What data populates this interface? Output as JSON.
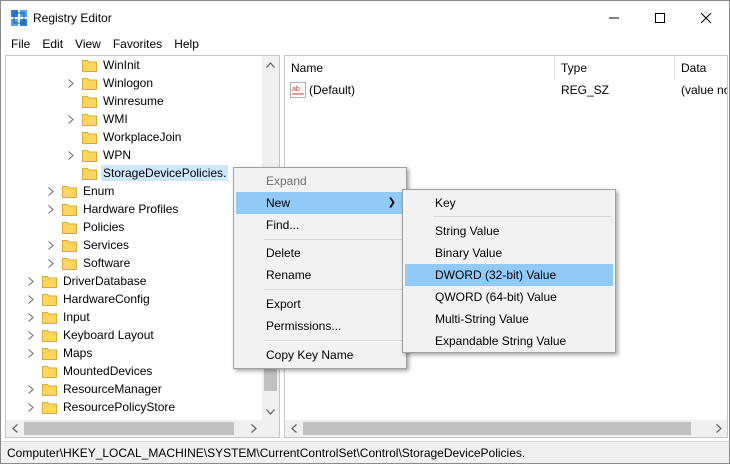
{
  "window": {
    "title": "Registry Editor",
    "controls": {
      "minimize": "minimize",
      "maximize": "maximize",
      "close": "close"
    }
  },
  "menubar": [
    "File",
    "Edit",
    "View",
    "Favorites",
    "Help"
  ],
  "tree": {
    "items": [
      {
        "label": "WinInit",
        "expandable": false
      },
      {
        "label": "Winlogon",
        "expandable": true
      },
      {
        "label": "Winresume",
        "expandable": false
      },
      {
        "label": "WMI",
        "expandable": true
      },
      {
        "label": "WorkplaceJoin",
        "expandable": false
      },
      {
        "label": "WPN",
        "expandable": true
      },
      {
        "label": "StorageDevicePolicies.",
        "expandable": false,
        "selected": true
      },
      {
        "label": "Enum",
        "expandable": true
      },
      {
        "label": "Hardware Profiles",
        "expandable": true
      },
      {
        "label": "Policies",
        "expandable": false
      },
      {
        "label": "Services",
        "expandable": true
      },
      {
        "label": "Software",
        "expandable": true
      },
      {
        "label": "DriverDatabase",
        "expandable": true
      },
      {
        "label": "HardwareConfig",
        "expandable": true
      },
      {
        "label": "Input",
        "expandable": true
      },
      {
        "label": "Keyboard Layout",
        "expandable": true
      },
      {
        "label": "Maps",
        "expandable": true
      },
      {
        "label": "MountedDevices",
        "expandable": false
      },
      {
        "label": "ResourceManager",
        "expandable": true
      },
      {
        "label": "ResourcePolicyStore",
        "expandable": true
      }
    ]
  },
  "list": {
    "columns": [
      "Name",
      "Type",
      "Data"
    ],
    "rows": [
      {
        "name": "(Default)",
        "type": "REG_SZ",
        "data": "(value not set)",
        "icon": "string-value-icon"
      }
    ]
  },
  "context_menu": {
    "items": {
      "expand": "Expand",
      "new": "New",
      "find": "Find...",
      "delete": "Delete",
      "rename": "Rename",
      "export": "Export",
      "permissions": "Permissions...",
      "copy_key_name": "Copy Key Name"
    }
  },
  "submenu": {
    "items": {
      "key": "Key",
      "string_value": "String Value",
      "binary_value": "Binary Value",
      "dword_value": "DWORD (32-bit) Value",
      "qword_value": "QWORD (64-bit) Value",
      "multi_string_value": "Multi-String Value",
      "expandable_string_value": "Expandable String Value"
    }
  },
  "status": {
    "path": "Computer\\HKEY_LOCAL_MACHINE\\SYSTEM\\CurrentControlSet\\Control\\StorageDevicePolicies."
  },
  "colors": {
    "selection": "#cce8ff",
    "menu_highlight": "#91c9f7",
    "folder": "#ffd65c"
  }
}
